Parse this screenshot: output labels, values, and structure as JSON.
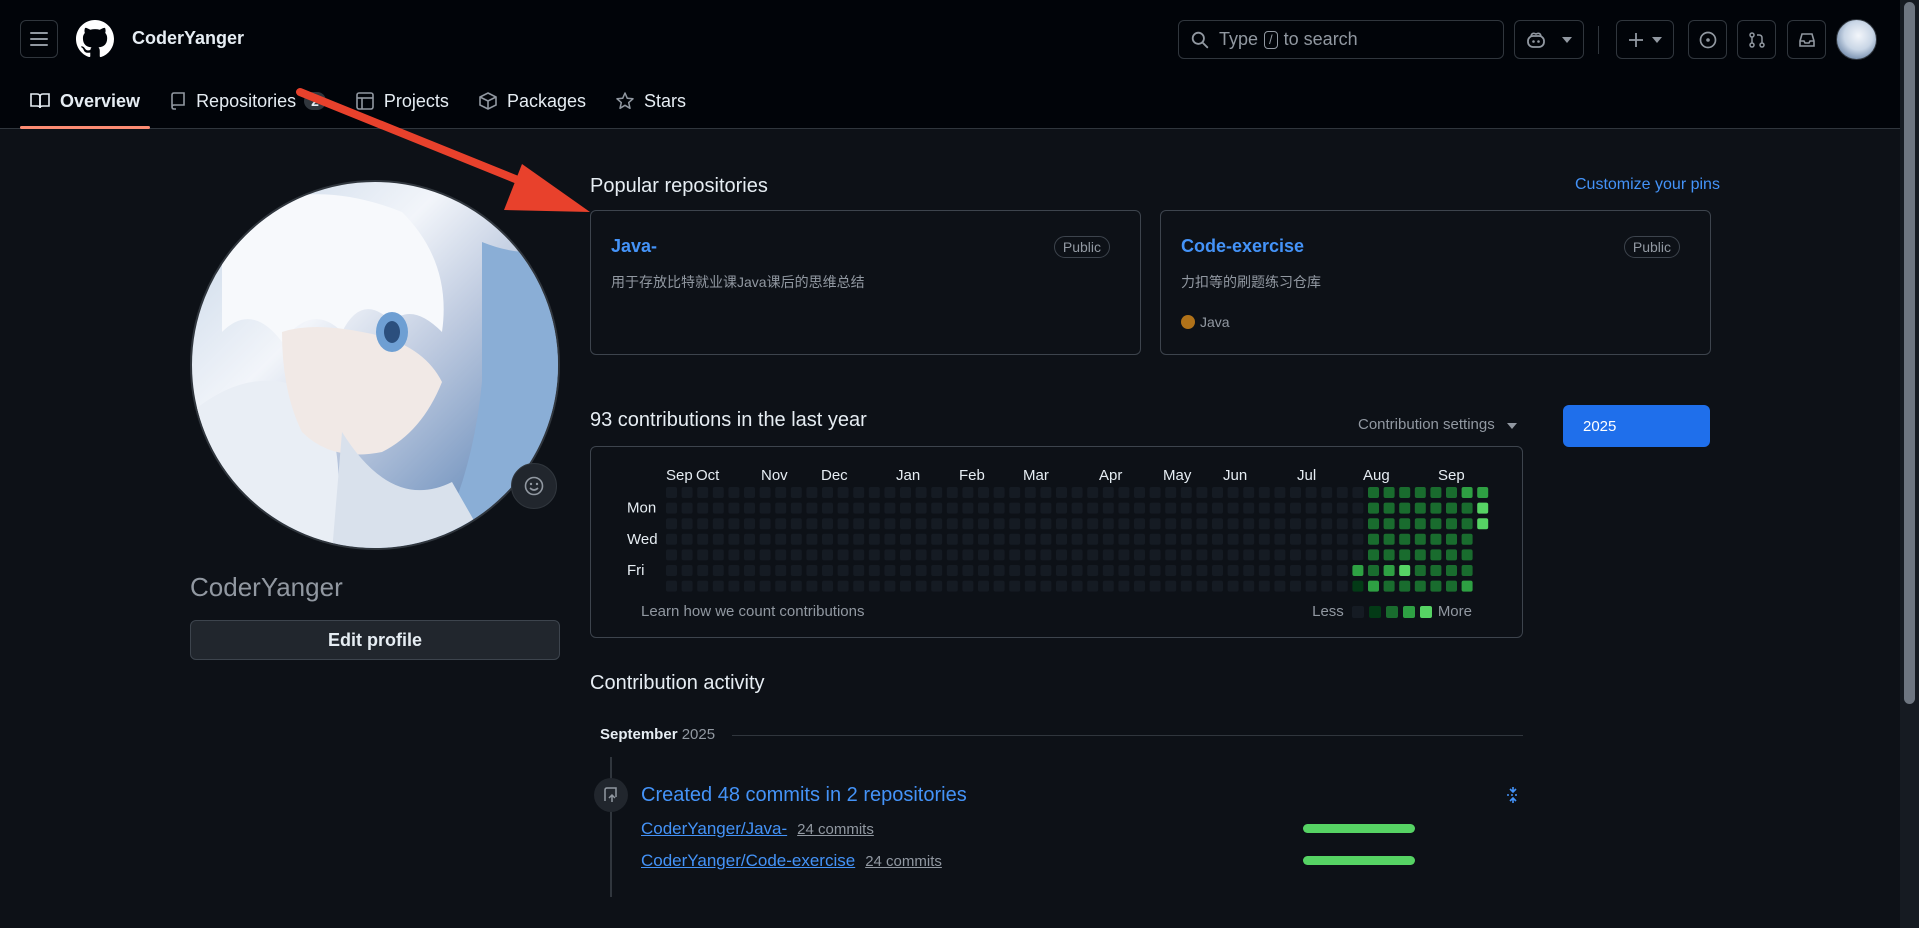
{
  "header": {
    "owner": "CoderYanger",
    "search_placeholder_pre": "Type",
    "search_key": "/",
    "search_placeholder_post": "to search"
  },
  "tabs": [
    {
      "label": "Overview",
      "icon": "book-icon",
      "active": true
    },
    {
      "label": "Repositories",
      "icon": "repo-icon",
      "count": "2"
    },
    {
      "label": "Projects",
      "icon": "table-icon"
    },
    {
      "label": "Packages",
      "icon": "package-icon"
    },
    {
      "label": "Stars",
      "icon": "star-icon"
    }
  ],
  "profile": {
    "name": "CoderYanger",
    "edit_label": "Edit profile"
  },
  "popular": {
    "title": "Popular repositories",
    "customize": "Customize your pins",
    "repos": [
      {
        "name": "Java-",
        "visibility": "Public",
        "description": "用于存放比特就业课Java课后的思维总结",
        "language": ""
      },
      {
        "name": "Code-exercise",
        "visibility": "Public",
        "description": "力扣等的刷题练习仓库",
        "language": "Java",
        "language_color": "#b07219"
      }
    ]
  },
  "contributions": {
    "title": "93 contributions in the last year",
    "settings": "Contribution settings",
    "year": "2025",
    "months": [
      "Sep",
      "Oct",
      "Nov",
      "Dec",
      "Jan",
      "Feb",
      "Mar",
      "Apr",
      "May",
      "Jun",
      "Jul",
      "Aug",
      "Sep"
    ],
    "days": [
      "Mon",
      "Wed",
      "Fri"
    ],
    "learn": "Learn how we count contributions",
    "less": "Less",
    "more": "More",
    "level_colors": [
      "#151b23",
      "#033a16",
      "#196c2e",
      "#2ea043",
      "#56d364"
    ]
  },
  "activity": {
    "title": "Contribution activity",
    "month": "September",
    "year": "2025",
    "summary": "Created 48 commits in 2 repositories",
    "repos": [
      {
        "name": "CoderYanger/Java-",
        "commits": "24 commits",
        "share": 1.0
      },
      {
        "name": "CoderYanger/Code-exercise",
        "commits": "24 commits",
        "share": 1.0
      }
    ]
  }
}
